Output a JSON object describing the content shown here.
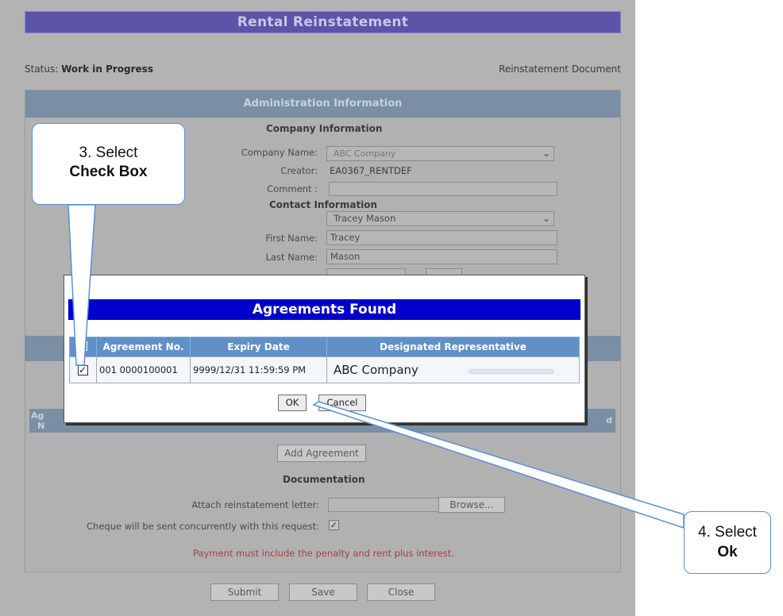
{
  "page": {
    "title": "Rental Reinstatement",
    "status_label": "Status:",
    "status_value": "Work in Progress",
    "doc_label": "Reinstatement Document"
  },
  "admin": {
    "header": "Administration Information",
    "company_section": "Company Information",
    "company_name_label": "Company Name:",
    "company_name_value": "ABC Company",
    "creator_label": "Creator:",
    "creator_value": "EA0367_RENTDEF",
    "comment_label": "Comment :",
    "contact_section": "Contact Information",
    "contact_select_value": "Tracey Mason",
    "first_name_label": "First Name:",
    "first_name_value": "Tracey",
    "last_name_label": "Last Name:",
    "last_name_value": "Mason"
  },
  "agreements_panel": {
    "col_left_partial": "Ag",
    "col_left_partial2": "N",
    "col_right_partial": "d",
    "add_button": "Add Agreement"
  },
  "documentation": {
    "title": "Documentation",
    "attach_label": "Attach reinstatement letter:",
    "browse_button": "Browse...",
    "cheque_label": "Cheque will be sent concurrently with this request:",
    "cheque_checked": true,
    "warning": "Payment must include the penalty and rent plus interest."
  },
  "footer_buttons": {
    "submit": "Submit",
    "save": "Save",
    "close": "Close"
  },
  "modal": {
    "title": "Agreements Found",
    "columns": [
      "Agreement No.",
      "Expiry Date",
      "Designated Representative"
    ],
    "rows": [
      {
        "checked": true,
        "agreement_no": "001 0000100001",
        "expiry": "9999/12/31 11:59:59 PM",
        "representative": "ABC Company"
      }
    ],
    "ok_button": "OK",
    "cancel_button": "Cancel"
  },
  "callouts": {
    "step3_line1": "3. Select",
    "step3_line2": "Check Box",
    "step4_line1": "4. Select",
    "step4_line2": "Ok"
  },
  "colors": {
    "title_bar": "#5b54a8",
    "modal_title": "#0000cc",
    "table_header": "#6190c7",
    "callout_border": "#5b8fd6",
    "warning": "#a54040"
  }
}
